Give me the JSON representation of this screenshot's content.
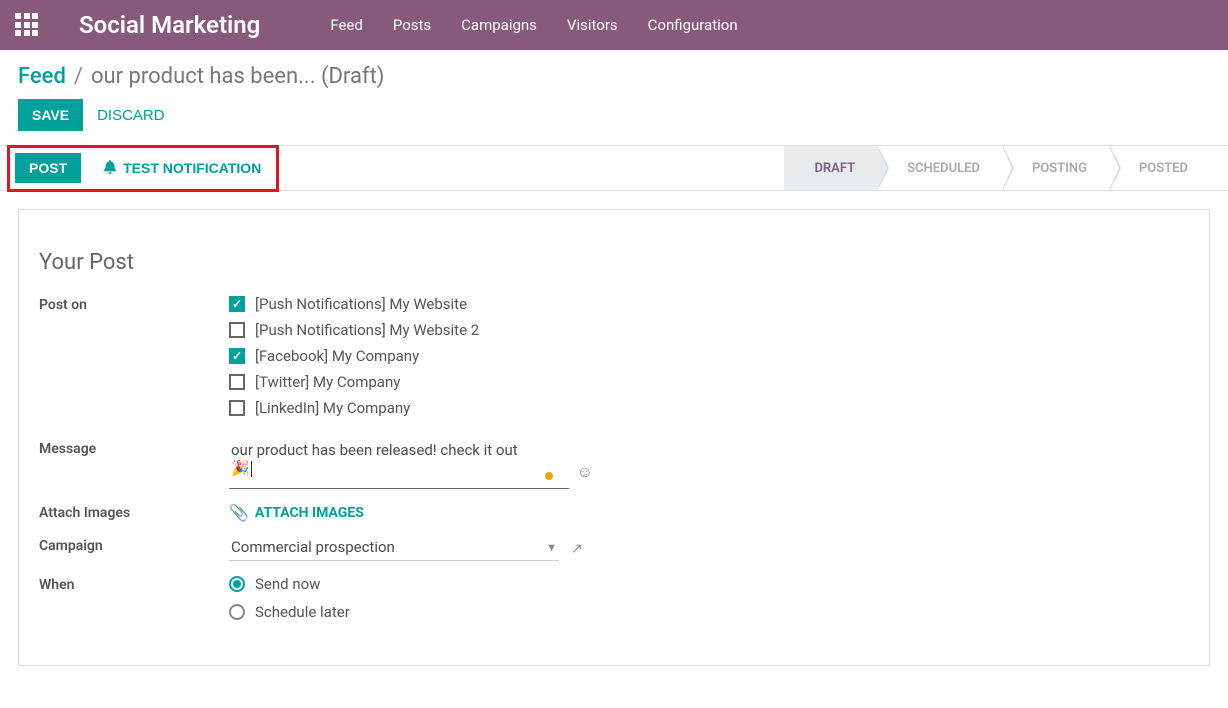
{
  "colors": {
    "primary": "#875a7b",
    "accent": "#00A09D"
  },
  "topbar": {
    "app_title": "Social Marketing",
    "nav": [
      "Feed",
      "Posts",
      "Campaigns",
      "Visitors",
      "Configuration"
    ]
  },
  "breadcrumb": {
    "root": "Feed",
    "current": "our product has been... (Draft)"
  },
  "actions": {
    "save": "SAVE",
    "discard": "DISCARD"
  },
  "statusbar": {
    "post": "POST",
    "test": "TEST NOTIFICATION",
    "stages": [
      "DRAFT",
      "SCHEDULED",
      "POSTING",
      "POSTED"
    ],
    "active_index": 0
  },
  "form": {
    "section_title": "Your Post",
    "labels": {
      "post_on": "Post on",
      "message": "Message",
      "attach_images": "Attach Images",
      "campaign": "Campaign",
      "when": "When"
    },
    "post_on_options": [
      {
        "label": "[Push Notifications] My Website",
        "checked": true
      },
      {
        "label": "[Push Notifications] My Website 2",
        "checked": false
      },
      {
        "label": "[Facebook] My Company",
        "checked": true
      },
      {
        "label": "[Twitter] My Company",
        "checked": false
      },
      {
        "label": "[LinkedIn] My Company",
        "checked": false
      }
    ],
    "message_text": "our product has been released! check it out🎉",
    "attach_images_button": "ATTACH IMAGES",
    "campaign_value": "Commercial prospection",
    "when_options": [
      {
        "label": "Send now",
        "checked": true
      },
      {
        "label": "Schedule later",
        "checked": false
      }
    ]
  }
}
